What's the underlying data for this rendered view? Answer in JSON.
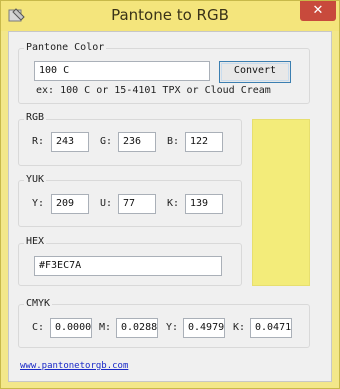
{
  "window": {
    "title": "Pantone to RGB",
    "close_glyph": "✕"
  },
  "pantone": {
    "label": "Pantone Color",
    "value": "100 C",
    "button": "Convert",
    "example": "ex: 100 C or 15-4101 TPX or Cloud Cream"
  },
  "rgb": {
    "label": "RGB",
    "r_label": "R:",
    "g_label": "G:",
    "b_label": "B:",
    "r": "243",
    "g": "236",
    "b": "122"
  },
  "yuk": {
    "label": "YUK",
    "y_label": "Y:",
    "u_label": "U:",
    "k_label": "K:",
    "y": "209",
    "u": "77",
    "k": "139"
  },
  "hex": {
    "label": "HEX",
    "value": "#F3EC7A"
  },
  "cmyk": {
    "label": "CMYK",
    "c_label": "C:",
    "m_label": "M:",
    "y_label": "Y:",
    "k_label": "K:",
    "c": "0.0000",
    "m": "0.0288",
    "y": "0.4979",
    "k": "0.0471"
  },
  "footer": {
    "link": "www.pantonetorgb.com"
  },
  "colors": {
    "swatch": "#F3EC7A",
    "title_bar": "#F4E57C",
    "close_button": "#C84A3C"
  },
  "icons": {
    "app": "pantone-app-icon",
    "close": "close-icon"
  }
}
